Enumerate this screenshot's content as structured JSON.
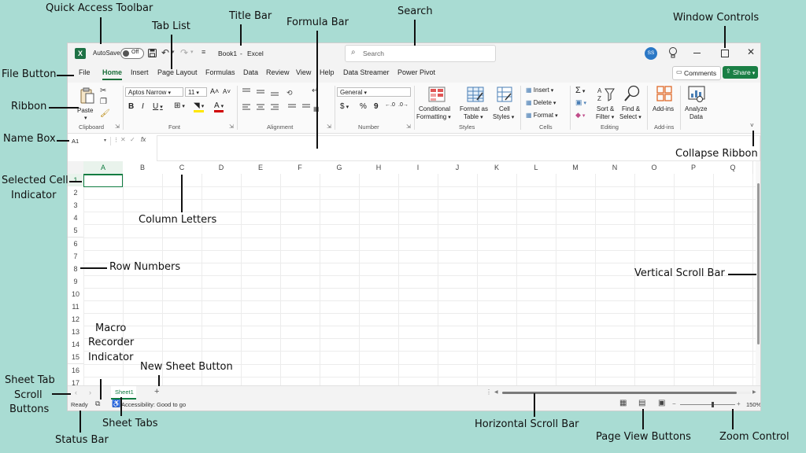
{
  "callouts": {
    "quick_access_toolbar": "Quick Access Toolbar",
    "tab_list": "Tab List",
    "title_bar": "Title Bar",
    "formula_bar": "Formula Bar",
    "search": "Search",
    "window_controls": "Window Controls",
    "file_button": "File Button",
    "ribbon": "Ribbon",
    "name_box": "Name Box",
    "collapse_ribbon": "Collapse Ribbon",
    "selected_cell_indicator_1": "Selected Cell",
    "selected_cell_indicator_2": "Indicator",
    "column_letters": "Column Letters",
    "row_numbers": "Row Numbers",
    "vertical_scroll_bar": "Vertical Scroll Bar",
    "macro_1": "Macro",
    "macro_2": "Recorder",
    "macro_3": "Indicator",
    "new_sheet_button": "New Sheet Button",
    "sheet_tab_scroll_1": "Sheet Tab",
    "sheet_tab_scroll_2": "Scroll",
    "sheet_tab_scroll_3": "Buttons",
    "status_bar": "Status Bar",
    "sheet_tabs": "Sheet Tabs",
    "horizontal_scroll_bar": "Horizontal Scroll Bar",
    "page_view_buttons": "Page View Buttons",
    "zoom_control": "Zoom Control"
  },
  "titlebar": {
    "autosave_label": "AutoSave",
    "autosave_state": "Off",
    "doc_title": "Book1",
    "separator": "-",
    "app_name": "Excel",
    "search_placeholder": "Search",
    "avatar_initials": "SS"
  },
  "menu": {
    "items": [
      "File",
      "Home",
      "Insert",
      "Page Layout",
      "Formulas",
      "Data",
      "Review",
      "View",
      "Help",
      "Data Streamer",
      "Power Pivot"
    ],
    "comments": "Comments",
    "share": "Share"
  },
  "ribbon": {
    "paste": "Paste",
    "clipboard": "Clipboard",
    "font_name": "Aptos Narrow",
    "font_size": "11",
    "bold": "B",
    "italic": "I",
    "underline": "U",
    "font_group": "Font",
    "alignment_group": "Alignment",
    "number_format": "General",
    "currency": "$",
    "percent": "%",
    "comma": "9",
    "number_group": "Number",
    "conditional_1": "Conditional",
    "conditional_2": "Formatting",
    "format_table_1": "Format as",
    "format_table_2": "Table",
    "cell_styles_1": "Cell",
    "cell_styles_2": "Styles",
    "styles_group": "Styles",
    "insert": "Insert",
    "delete": "Delete",
    "format": "Format",
    "cells_group": "Cells",
    "sort_1": "Sort &",
    "sort_2": "Filter",
    "find_1": "Find &",
    "find_2": "Select",
    "editing_group": "Editing",
    "addins": "Add-ins",
    "addins_group": "Add-ins",
    "analyze_1": "Analyze",
    "analyze_2": "Data"
  },
  "formula_bar": {
    "name_box": "A1",
    "fx": "fx"
  },
  "grid": {
    "columns": [
      "A",
      "B",
      "C",
      "D",
      "E",
      "F",
      "G",
      "H",
      "I",
      "J",
      "K",
      "L",
      "M",
      "N",
      "O",
      "P",
      "Q"
    ],
    "rows": [
      "1",
      "2",
      "3",
      "4",
      "5",
      "6",
      "7",
      "8",
      "9",
      "10",
      "11",
      "12",
      "13",
      "14",
      "15",
      "16",
      "17"
    ]
  },
  "sheetbar": {
    "sheet_name": "Sheet1",
    "add": "+"
  },
  "statusbar": {
    "ready": "Ready",
    "accessibility": "Accessibility: Good to go",
    "zoom": "150%"
  },
  "colors": {
    "accent": "#1a6e3a",
    "background": "#a9dcd3"
  }
}
